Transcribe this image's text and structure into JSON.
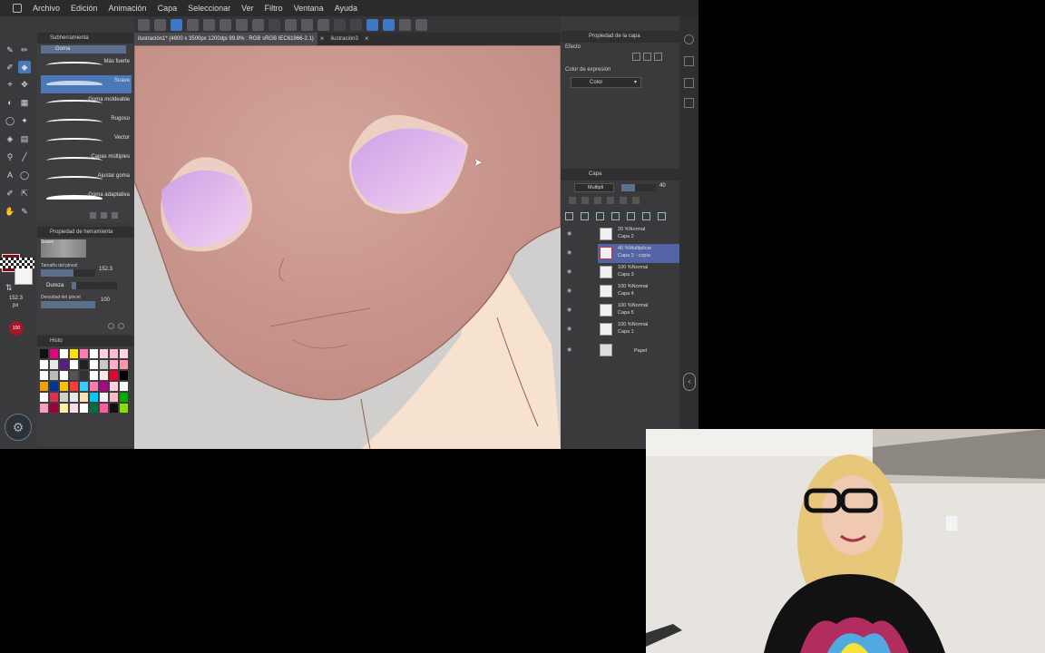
{
  "menu": [
    "Archivo",
    "Edición",
    "Animación",
    "Capa",
    "Seleccionar",
    "Ver",
    "Filtro",
    "Ventana",
    "Ayuda"
  ],
  "tabs": {
    "active": "ilustración1* (4800 x 3500px 1200dpi 99.8% : RGB sRGB IEC61966-2.1)",
    "second": "ilustración3"
  },
  "subtool": {
    "header": "Subherramienta",
    "group": "Goma",
    "brushes": [
      {
        "label": "Más fuerte"
      },
      {
        "label": "Suave"
      },
      {
        "label": "Goma moldeable"
      },
      {
        "label": "Rugoso"
      },
      {
        "label": "Vector"
      },
      {
        "label": "Capas múltiples"
      },
      {
        "label": "Ajustar goma"
      },
      {
        "label": "Goma adaptativa"
      }
    ]
  },
  "toolprop": {
    "header": "Propiedad de herramienta",
    "preset_name": "Suave",
    "brush_size_label": "Tamaño del pincel",
    "brush_size_value": "152.3",
    "hardness_label": "Dureza",
    "density_label": "Densidad del pincel",
    "density_value": "100",
    "size_side_value": "152.3",
    "size_side_unit": "px",
    "opacity_badge": "100"
  },
  "colorset": {
    "header": "Histo",
    "swatches": [
      "#111111",
      "#e6007e",
      "#ffffff",
      "#f9e400",
      "#ff7bb6",
      "#ffffff",
      "#ffd0e4",
      "#ffbad2",
      "#ffd3e0",
      "#ffffff",
      "#e8e8e8",
      "#5a1a8a",
      "#ffffff",
      "#222222",
      "#ffffff",
      "#c8c8c8",
      "#ffb0c8",
      "#ff97a8",
      "#ffffff",
      "#bbbbbb",
      "#ffffff",
      "#555555",
      "#333333",
      "#ffffff",
      "#ffe6e6",
      "#f00030",
      "#000000",
      "#f3a000",
      "#00349a",
      "#f7c400",
      "#ff3a3a",
      "#33cfff",
      "#ff7aa8",
      "#b4008a",
      "#ffcee0",
      "#f8f8f8",
      "#ffffff",
      "#e03050",
      "#d0d0d0",
      "#e8e8e8",
      "#ffe0b0",
      "#00c8ff",
      "#f2f2f2",
      "#ffb8c8",
      "#00b000",
      "#ff9ac0",
      "#a00040",
      "#fff0a0",
      "#ffd8e8",
      "#ffffff",
      "#007040",
      "#ff5aa0",
      "#111111",
      "#88e000"
    ]
  },
  "layers_panel": {
    "property_header": "Propiedad de la capa",
    "effect_label": "Efecto",
    "expression_label": "Color de expresión",
    "expression_value": "Color",
    "layer_header": "Capa",
    "blend_mode": "Multipli",
    "opacity_value": "40",
    "layers": [
      {
        "mode": "20 %Normal",
        "name": "Capa 2",
        "selected": false
      },
      {
        "mode": "40 %Multiplicar",
        "name": "Capa 3 - copia",
        "selected": true
      },
      {
        "mode": "100 %Normal",
        "name": "Capa 3",
        "selected": false
      },
      {
        "mode": "100 %Normal",
        "name": "Capa 4",
        "selected": false
      },
      {
        "mode": "100 %Normal",
        "name": "Capa 5",
        "selected": false
      },
      {
        "mode": "100 %Normal",
        "name": "Capa 1",
        "selected": false
      },
      {
        "mode": "",
        "name": "Papel",
        "selected": false
      }
    ]
  },
  "colors": {
    "ui_bg": "#3a3a3c",
    "accent": "#4a78b8",
    "main_color": "#7a0f17",
    "skin": "#c9988f",
    "eye": "#e3b8ec"
  }
}
